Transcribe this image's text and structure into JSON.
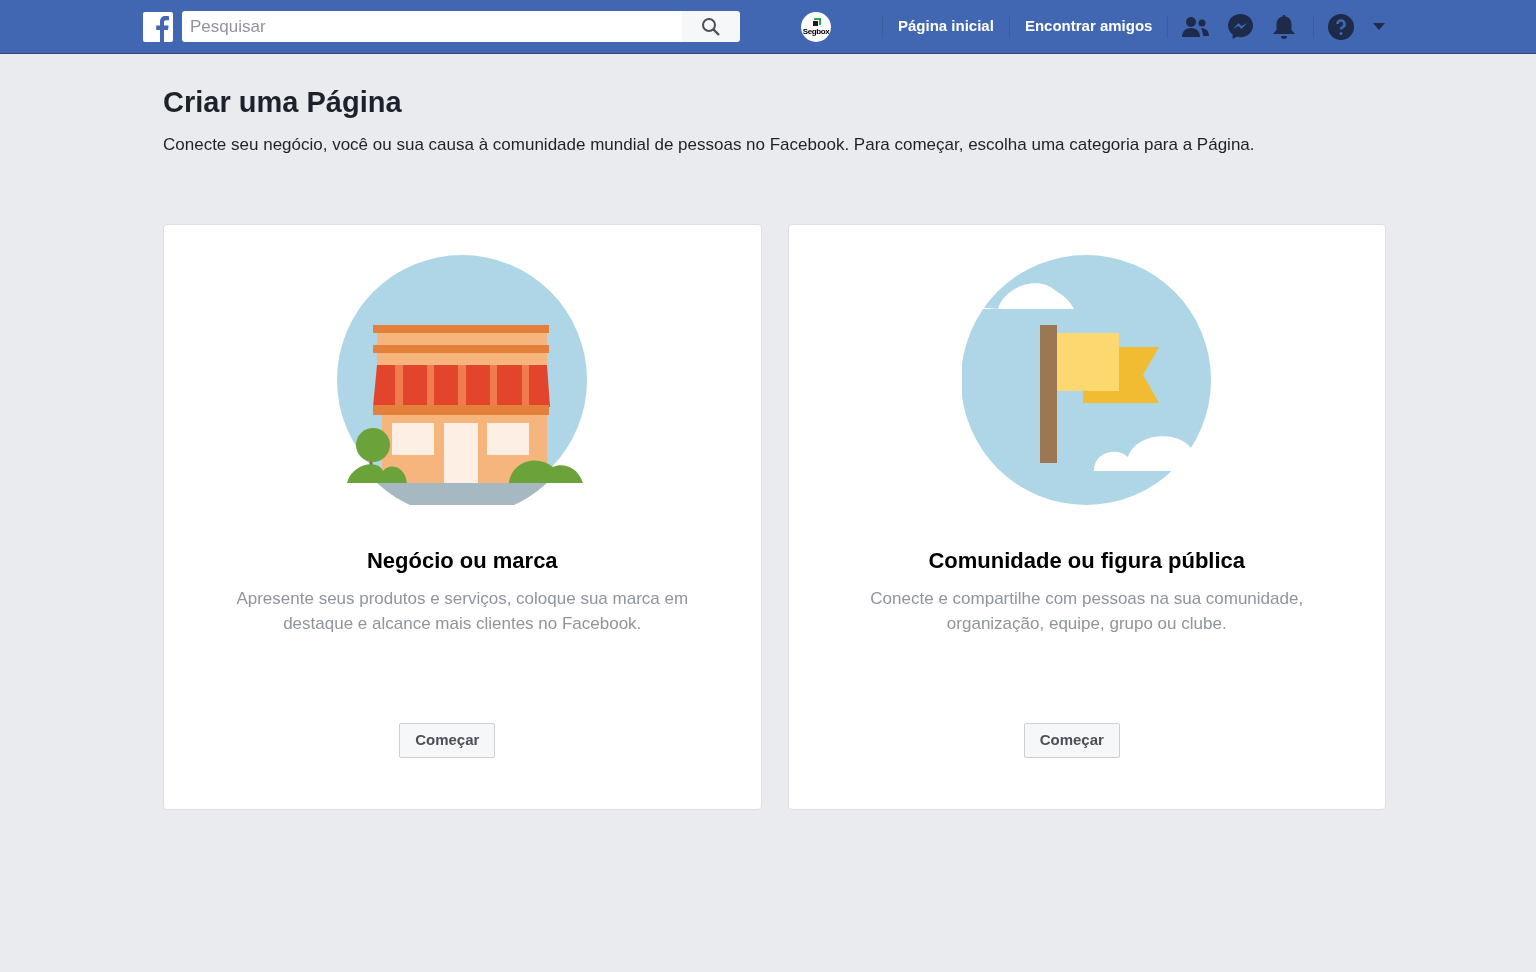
{
  "top_bar": {
    "search": {
      "placeholder": "Pesquisar"
    },
    "profile_label": "Segbox",
    "links": [
      "Página inicial",
      "Encontrar amigos"
    ]
  },
  "page": {
    "title": "Criar uma Página",
    "description": "Conecte seu negócio, você ou sua causa à comunidade mundial de pessoas no Facebook. Para começar, escolha uma categoria para a Página."
  },
  "cards": [
    {
      "kind": "store",
      "title": "Negócio ou marca",
      "description": "Apresente seus produtos e serviços, coloque sua marca em destaque e alcance mais clientes no Facebook.",
      "button": "Começar"
    },
    {
      "kind": "flag",
      "title": "Comunidade ou figura pública",
      "description": "Conecte e compartilhe com pessoas na sua comunidade, organização, equipe, grupo ou clube.",
      "button": "Começar"
    }
  ]
}
